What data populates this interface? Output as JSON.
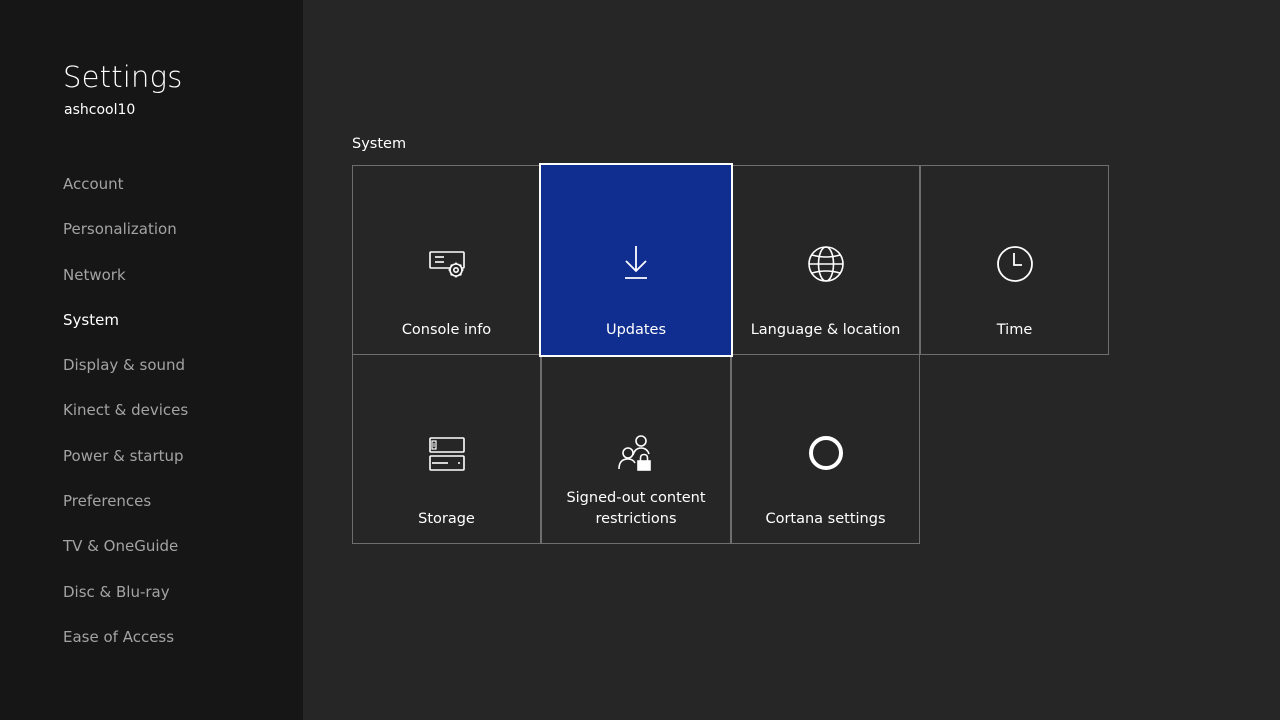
{
  "app": {
    "title": "Settings",
    "gamertag": "ashcool10"
  },
  "sidebar": {
    "items": [
      {
        "label": "Account",
        "active": false
      },
      {
        "label": "Personalization",
        "active": false
      },
      {
        "label": "Network",
        "active": false
      },
      {
        "label": "System",
        "active": true
      },
      {
        "label": "Display & sound",
        "active": false
      },
      {
        "label": "Kinect & devices",
        "active": false
      },
      {
        "label": "Power & startup",
        "active": false
      },
      {
        "label": "Preferences",
        "active": false
      },
      {
        "label": "TV & OneGuide",
        "active": false
      },
      {
        "label": "Disc & Blu-ray",
        "active": false
      },
      {
        "label": "Ease of Access",
        "active": false
      }
    ]
  },
  "main": {
    "section_title": "System",
    "tiles": [
      {
        "label": "Console info",
        "icon": "console-info-icon"
      },
      {
        "label": "Updates",
        "icon": "download-arrow-icon",
        "focused": true
      },
      {
        "label": "Language & location",
        "icon": "globe-icon"
      },
      {
        "label": "Time",
        "icon": "clock-icon"
      },
      {
        "label": "Storage",
        "icon": "storage-drive-icon"
      },
      {
        "label": "Signed-out content restrictions",
        "icon": "users-lock-icon"
      },
      {
        "label": "Cortana settings",
        "icon": "cortana-ring-icon"
      }
    ]
  },
  "colors": {
    "sidebar_bg": "#161616",
    "main_bg": "#262626",
    "focus_tile": "#0f2e8f",
    "tile_border": "#6e6e6e",
    "nav_inactive": "#a3a3a3"
  }
}
